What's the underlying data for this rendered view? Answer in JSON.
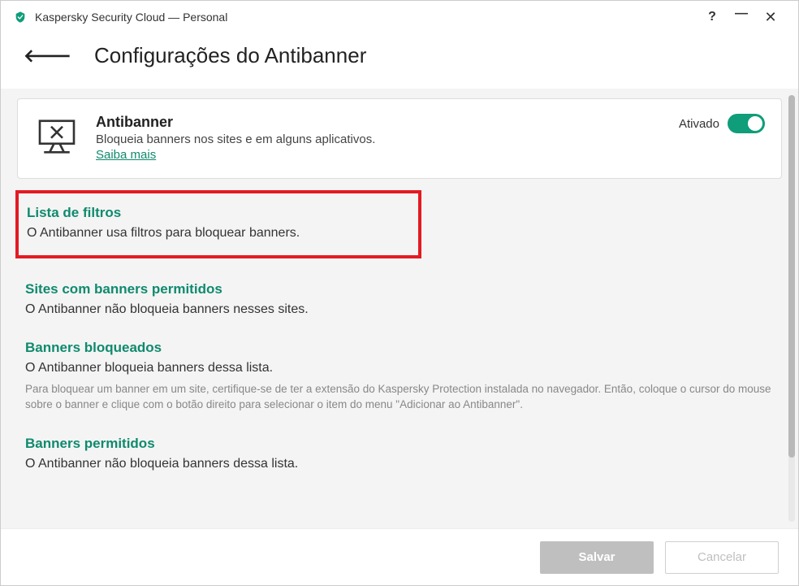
{
  "window": {
    "title": "Kaspersky Security Cloud — Personal"
  },
  "header": {
    "page_title": "Configurações do Antibanner"
  },
  "feature": {
    "title": "Antibanner",
    "description": "Bloqueia banners nos sites e em alguns aplicativos.",
    "learn_more": "Saiba mais",
    "toggle_label": "Ativado"
  },
  "sections": {
    "filters": {
      "title": "Lista de filtros",
      "desc": "O Antibanner usa filtros para bloquear banners."
    },
    "allowed_sites": {
      "title": "Sites com banners permitidos",
      "desc": "O Antibanner não bloqueia banners nesses sites."
    },
    "blocked": {
      "title": "Banners bloqueados",
      "desc": "O Antibanner bloqueia banners dessa lista.",
      "note": "Para bloquear um banner em um site, certifique-se de ter a extensão do Kaspersky Protection instalada no navegador. Então, coloque o cursor do mouse sobre o banner e clique com o botão direito para selecionar o item do menu \"Adicionar ao Antibanner\"."
    },
    "allowed": {
      "title": "Banners permitidos",
      "desc": "O Antibanner não bloqueia banners dessa lista."
    }
  },
  "footer": {
    "save": "Salvar",
    "cancel": "Cancelar"
  }
}
